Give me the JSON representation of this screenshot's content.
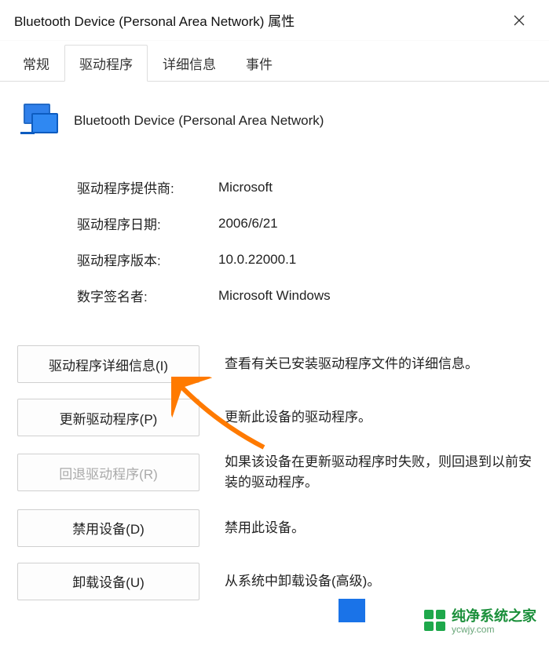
{
  "window": {
    "title": "Bluetooth Device (Personal Area Network) 属性"
  },
  "tabs": [
    {
      "label": "常规"
    },
    {
      "label": "驱动程序"
    },
    {
      "label": "详细信息"
    },
    {
      "label": "事件"
    }
  ],
  "active_tab_index": 1,
  "device": {
    "name": "Bluetooth Device (Personal Area Network)"
  },
  "info": {
    "provider_label": "驱动程序提供商:",
    "provider_value": "Microsoft",
    "date_label": "驱动程序日期:",
    "date_value": "2006/6/21",
    "version_label": "驱动程序版本:",
    "version_value": "10.0.22000.1",
    "signer_label": "数字签名者:",
    "signer_value": "Microsoft Windows"
  },
  "actions": {
    "details": {
      "label": "驱动程序详细信息(I)",
      "desc": "查看有关已安装驱动程序文件的详细信息。"
    },
    "update": {
      "label": "更新驱动程序(P)",
      "desc": "更新此设备的驱动程序。"
    },
    "rollback": {
      "label": "回退驱动程序(R)",
      "desc": "如果该设备在更新驱动程序时失败，则回退到以前安装的驱动程序。"
    },
    "disable": {
      "label": "禁用设备(D)",
      "desc": "禁用此设备。"
    },
    "uninstall": {
      "label": "卸载设备(U)",
      "desc": "从系统中卸载设备(高级)。"
    }
  },
  "watermark": {
    "brand": "纯净系统之家",
    "url": "ycwjy.com"
  }
}
